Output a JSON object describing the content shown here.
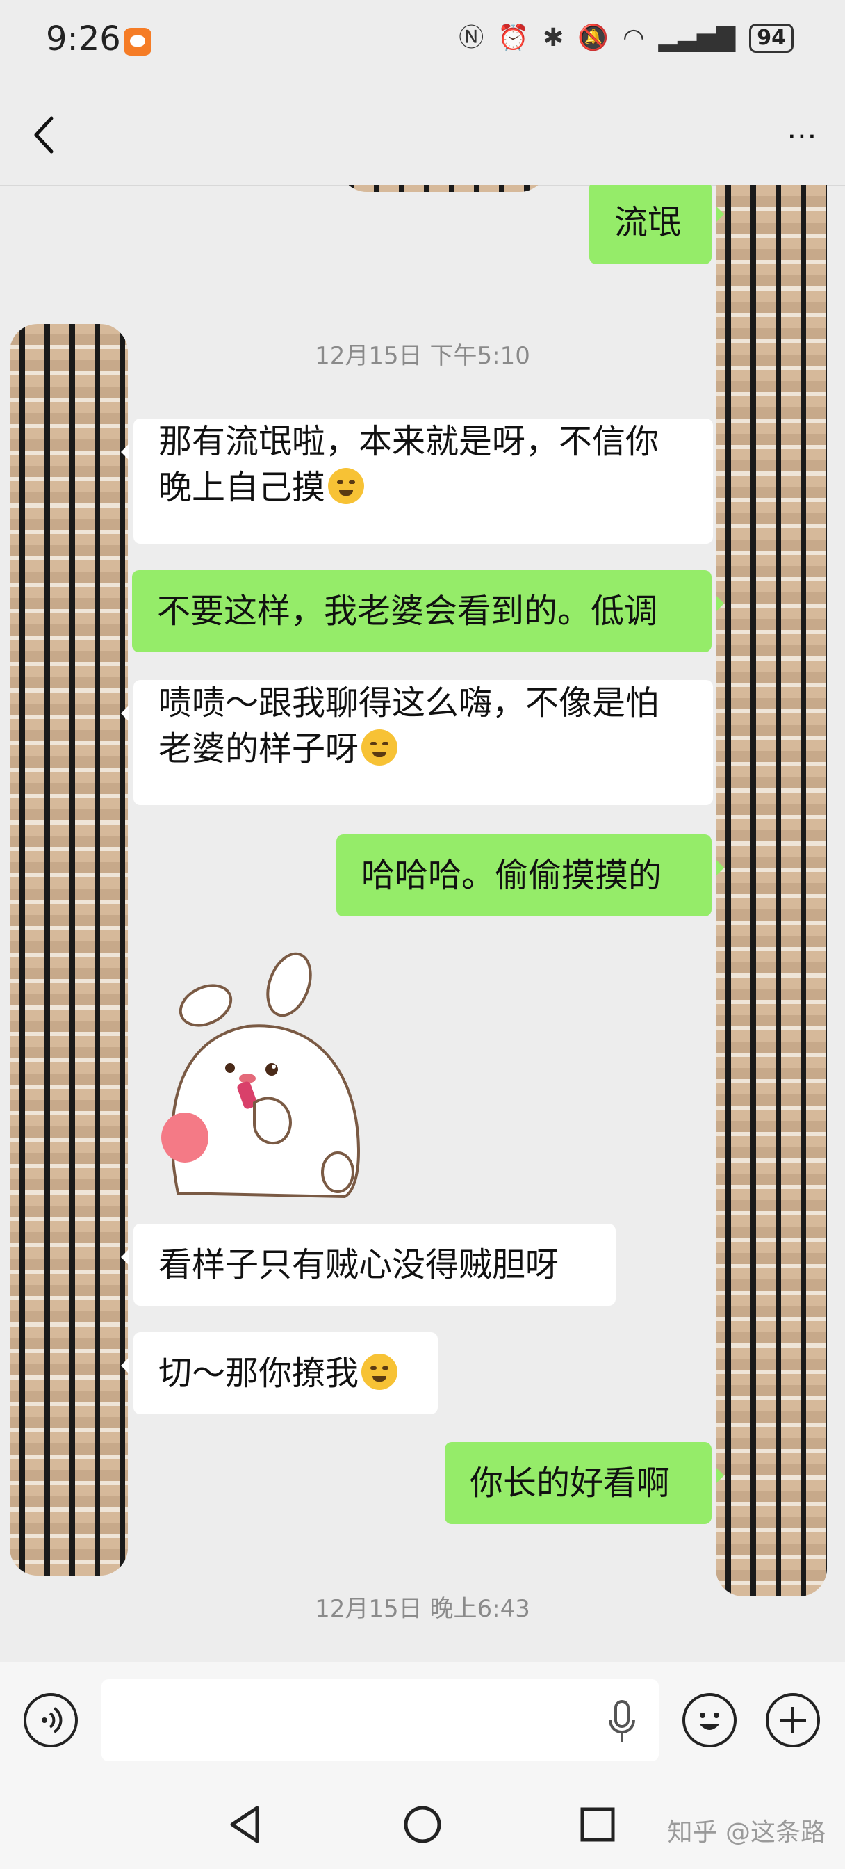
{
  "status_bar": {
    "time": "9:26",
    "battery": "94",
    "icons": [
      "nfc-icon",
      "alarm-icon",
      "bluetooth-icon",
      "mute-icon",
      "wifi-icon",
      "signal-icon"
    ]
  },
  "header": {
    "title": "",
    "back_icon": "chevron-left-icon",
    "more_icon": "more-dots-icon"
  },
  "messages": [
    {
      "side": "out",
      "text": "流氓"
    },
    {
      "type": "timestamp",
      "text": "12月15日 下午5:10"
    },
    {
      "side": "in",
      "text": "那有流氓啦，本来就是呀，不信你\n晚上自己摸",
      "emoji": "shush-face"
    },
    {
      "side": "out",
      "text": "不要这样，我老婆会看到的。低调"
    },
    {
      "side": "in",
      "text": "啧啧～跟我聊得这么嗨，不像是怕\n老婆的样子呀",
      "emoji": "laugh-cry-face"
    },
    {
      "side": "out",
      "text": "哈哈哈。偷偷摸摸的"
    },
    {
      "side": "in",
      "type": "sticker",
      "sticker": "bunny-lipstick-sticker"
    },
    {
      "side": "in",
      "text": "看样子只有贼心没得贼胆呀"
    },
    {
      "side": "in",
      "text": "切～那你撩我",
      "emoji": "laugh-cry-face"
    },
    {
      "side": "out",
      "text": "你长的好看啊"
    },
    {
      "type": "timestamp",
      "text": "12月15日 晚上6:43"
    }
  ],
  "input_bar": {
    "placeholder": "",
    "voice_icon": "voice-icon",
    "mic_icon": "mic-icon",
    "emoji_icon": "emoji-icon",
    "plus_icon": "plus-icon"
  },
  "nav_bar": {
    "watermark": "知乎 @这条路"
  },
  "colors": {
    "background": "#ededed",
    "outgoing_bubble": "#95ec69",
    "incoming_bubble": "#ffffff"
  }
}
